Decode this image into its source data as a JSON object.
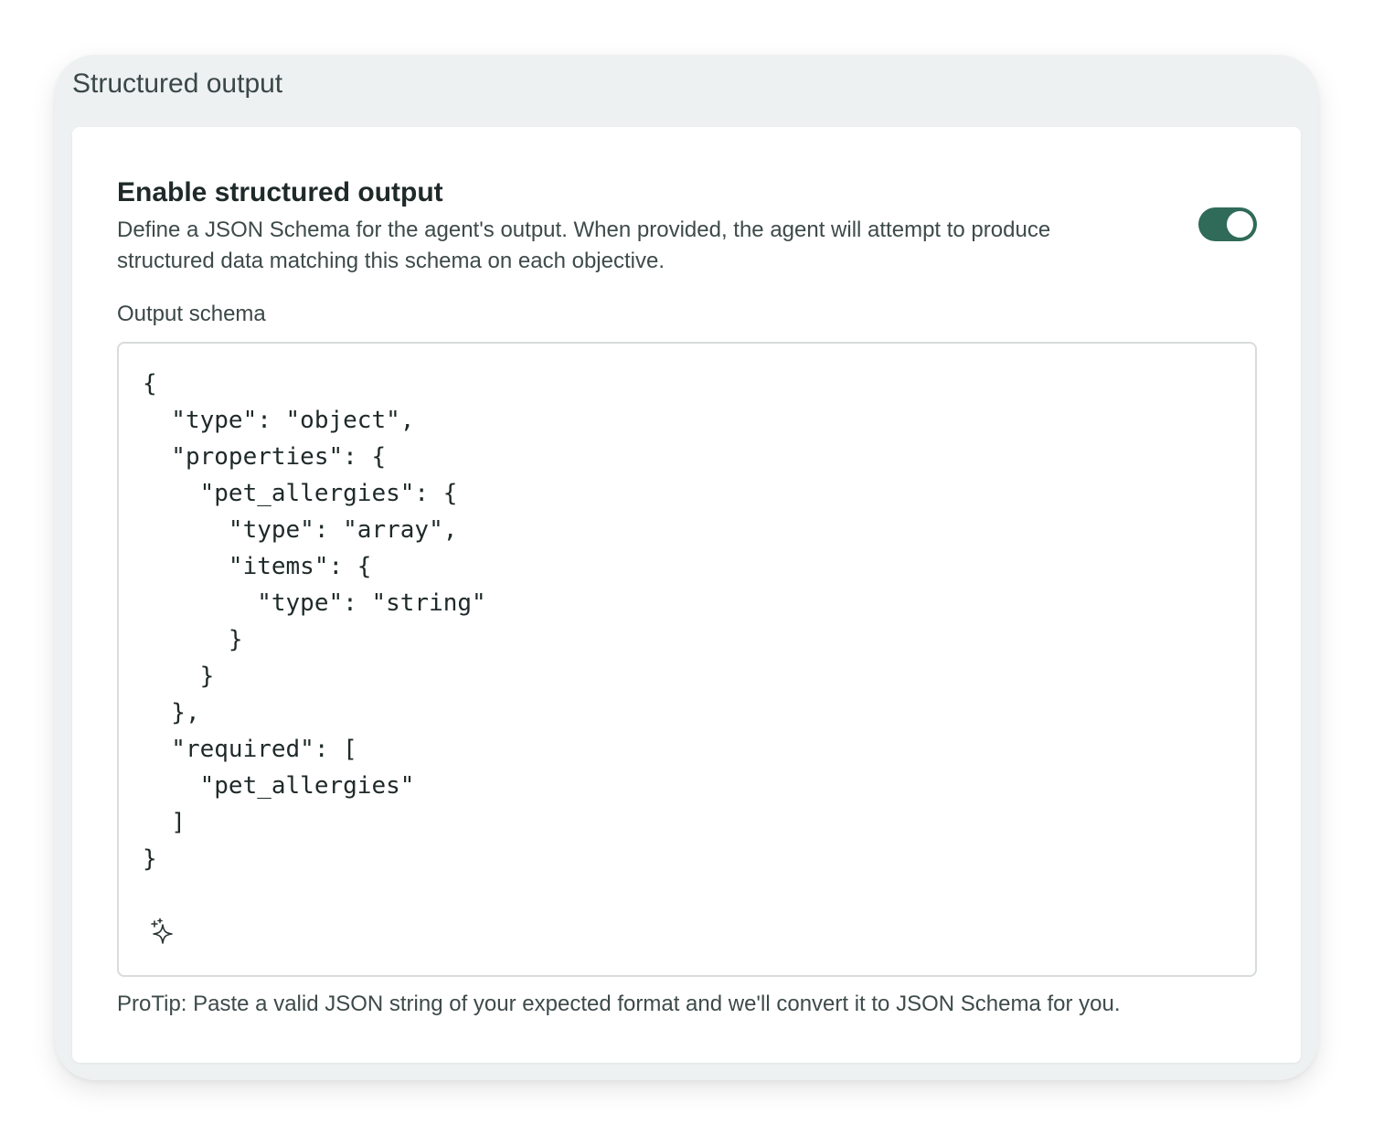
{
  "panel": {
    "title": "Structured output"
  },
  "structured_output": {
    "heading": "Enable structured output",
    "description": "Define a JSON Schema for the agent's output. When provided, the agent will attempt to produce structured data matching this schema on each objective.",
    "toggle_enabled": true,
    "toggle_color": "#2f6b58"
  },
  "schema_field": {
    "label": "Output schema",
    "value": "{\n  \"type\": \"object\",\n  \"properties\": {\n    \"pet_allergies\": {\n      \"type\": \"array\",\n      \"items\": {\n        \"type\": \"string\"\n      }\n    }\n  },\n  \"required\": [\n    \"pet_allergies\"\n  ]\n}",
    "assist_icon": "sparkle-icon"
  },
  "protip": "ProTip: Paste a valid JSON string of your expected format and we'll convert it to JSON Schema for you."
}
